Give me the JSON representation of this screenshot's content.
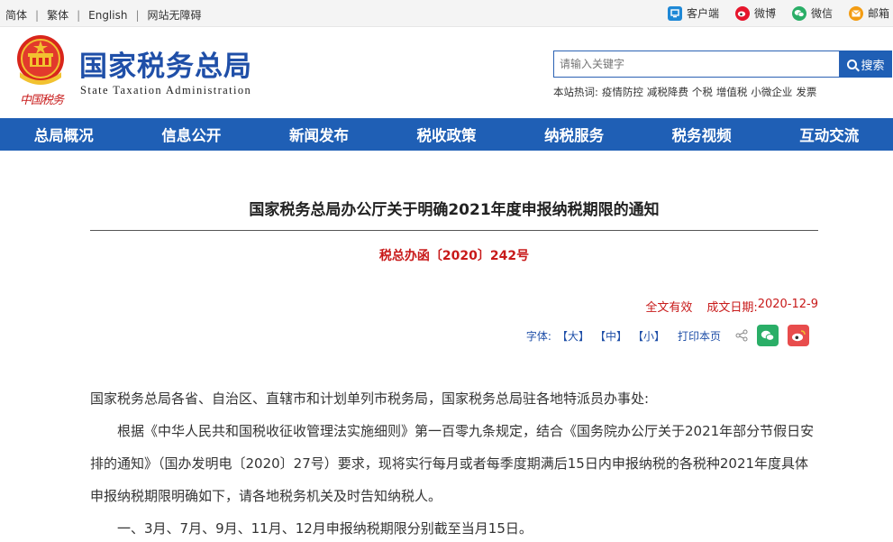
{
  "topbar": {
    "lang_simplified": "简体",
    "lang_traditional": "繁体",
    "lang_english": "English",
    "accessibility": "网站无障碍",
    "client": "客户端",
    "weibo": "微博",
    "wechat": "微信",
    "mail": "邮箱",
    "colors": {
      "client": "#1e88d6",
      "weibo": "#e6162d",
      "wechat": "#2aae67",
      "mail": "#f39c12"
    }
  },
  "header": {
    "emblem_caption": "中国税务",
    "site_title": "国家税务总局",
    "site_subtitle": "State Taxation Administration",
    "search_placeholder": "请输入关键字",
    "search_button": "搜索",
    "hotwords_label": "本站热词:",
    "hotwords": [
      "疫情防控",
      "减税降费",
      "个税",
      "增值税",
      "小微企业",
      "发票"
    ]
  },
  "nav": {
    "items": [
      "总局概况",
      "信息公开",
      "新闻发布",
      "税收政策",
      "纳税服务",
      "税务视频",
      "互动交流"
    ],
    "color": "#1f5fb5"
  },
  "article": {
    "title": "国家税务总局办公厅关于明确2021年度申报纳税期限的通知",
    "doc_number": "税总办函〔2020〕242号",
    "validity": "全文有效",
    "date_label": "成文日期:",
    "date_value": "2020-12-9",
    "font_label": "字体:",
    "font_large": "【大】",
    "font_medium": "【中】",
    "font_small": "【小】",
    "print": "打印本页",
    "paragraphs": [
      "国家税务总局各省、自治区、直辖市和计划单列市税务局，国家税务总局驻各地特派员办事处:",
      "根据《中华人民共和国税收征收管理法实施细则》第一百零九条规定，结合《国务院办公厅关于2021年部分节假日安排的通知》（国办发明电〔2020〕27号）要求，现将实行每月或者每季度期满后15日内申报纳税的各税种2021年度具体申报纳税期限明确如下，请各地税务机关及时告知纳税人。",
      "一、3月、7月、9月、11月、12月申报纳税期限分别截至当月15日。"
    ]
  }
}
